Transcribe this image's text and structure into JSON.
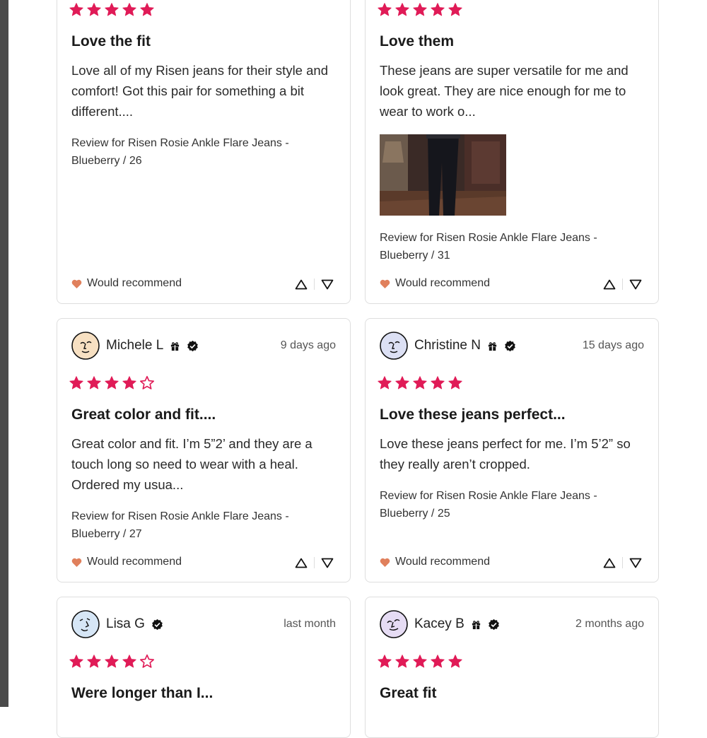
{
  "colors": {
    "star": "#e01b57",
    "heart": "#e0805c",
    "border": "#dedede"
  },
  "reviews": [
    {
      "title": "Love the fit",
      "body": "Love all of my Risen jeans for their style and comfort! Got this pair for something a bit different....",
      "variant": "Review for Risen Rosie Ankle Flare Jeans - Blueberry / 26",
      "rating": 5,
      "recommend": "Would recommend",
      "has_photo": false
    },
    {
      "title": "Love them",
      "body": "These jeans are super versatile for me and look great. They are nice enough for me to wear to work o...",
      "variant": "Review for Risen Rosie Ankle Flare Jeans - Blueberry / 31",
      "rating": 5,
      "recommend": "Would recommend",
      "has_photo": true
    },
    {
      "name": "Michele L",
      "date": "9 days ago",
      "badges": [
        "gift-icon",
        "verified-icon"
      ],
      "avatar_bg": "#f7e0c2",
      "title": "Great color and fit....",
      "body": "Great color and fit. I’m 5”2’ and they are a touch long so need to wear with a heal. Ordered my usua...",
      "variant": "Review for Risen Rosie Ankle Flare Jeans - Blueberry / 27",
      "rating": 4,
      "recommend": "Would recommend"
    },
    {
      "name": "Christine N",
      "date": "15 days ago",
      "badges": [
        "gift-icon",
        "verified-icon"
      ],
      "avatar_bg": "#dce0f4",
      "title": "Love these jeans perfect...",
      "body": "Love these jeans perfect for me. I’m 5’2” so they really aren’t cropped.",
      "variant": "Review for Risen Rosie Ankle Flare Jeans - Blueberry / 25",
      "rating": 5,
      "recommend": "Would recommend"
    },
    {
      "name": "Lisa G",
      "date": "last month",
      "badges": [
        "verified-icon"
      ],
      "avatar_bg": "#d6e6f6",
      "title": "Were longer than I...",
      "rating": 4
    },
    {
      "name": "Kacey B",
      "date": "2 months ago",
      "badges": [
        "gift-icon",
        "verified-icon"
      ],
      "avatar_bg": "#e6dcf4",
      "title": "Great fit",
      "rating": 5
    }
  ]
}
